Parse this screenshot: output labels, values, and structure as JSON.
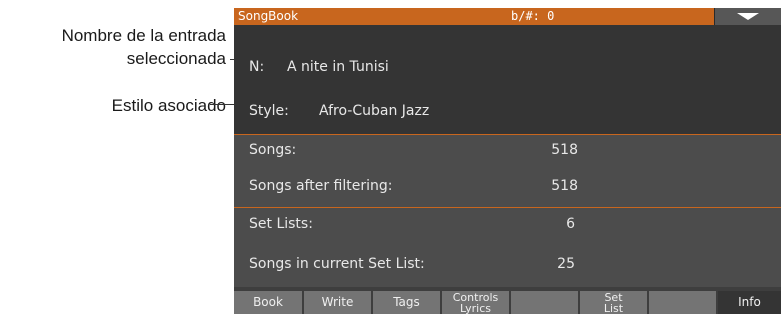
{
  "callouts": {
    "entry_name": [
      "Nombre de la entrada",
      "seleccionada"
    ],
    "style": "Estilo asociado"
  },
  "header": {
    "app_name": "SongBook",
    "key_signature": "b/#: 0",
    "menu_icon": "triangle-down-icon"
  },
  "entry": {
    "name_label": "N:",
    "name_value": "A nite in Tunisi",
    "style_label": "Style:",
    "style_value": "Afro-Cuban Jazz"
  },
  "counts": {
    "songs_label": "Songs:",
    "songs_value": "518",
    "filtered_label": "Songs after filtering:",
    "filtered_value": "518"
  },
  "setlists": {
    "setlists_label": "Set Lists:",
    "setlists_value": "6",
    "current_label": "Songs in current Set List:",
    "current_value": "25"
  },
  "tabs": {
    "book": "Book",
    "write": "Write",
    "tags": "Tags",
    "controls_lyrics": [
      "Controls",
      "Lyrics"
    ],
    "blank_1": "",
    "set_list": [
      "Set",
      "List"
    ],
    "blank_2": "",
    "info": "Info"
  },
  "colors": {
    "accent": "#c8661e",
    "panel_dark": "#343434",
    "panel_mid": "#4c4c4c",
    "tab": "#747474"
  }
}
